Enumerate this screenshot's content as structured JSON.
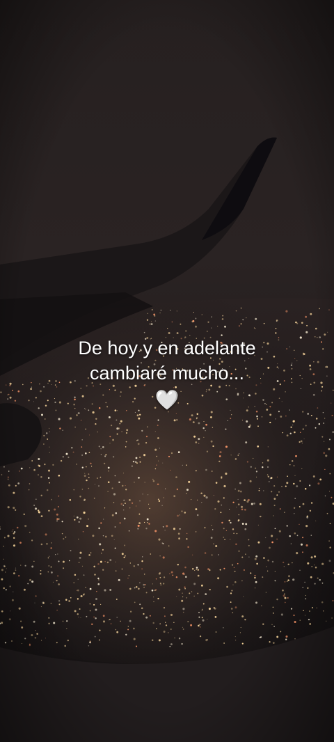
{
  "caption": {
    "line1": "De hoy y en adelante",
    "line2": "cambiaré mucho...",
    "heart": "🤍"
  },
  "colors": {
    "sky": "#2a2323",
    "wing": "#1b1718",
    "wing_tip": "#0e0c10",
    "city_glow": "#ffdca0",
    "window_frame": "#221d1e",
    "text": "#ffffff"
  },
  "scene": {
    "icon_names": [
      "airplane-wing",
      "city-lights",
      "window-frame"
    ]
  }
}
